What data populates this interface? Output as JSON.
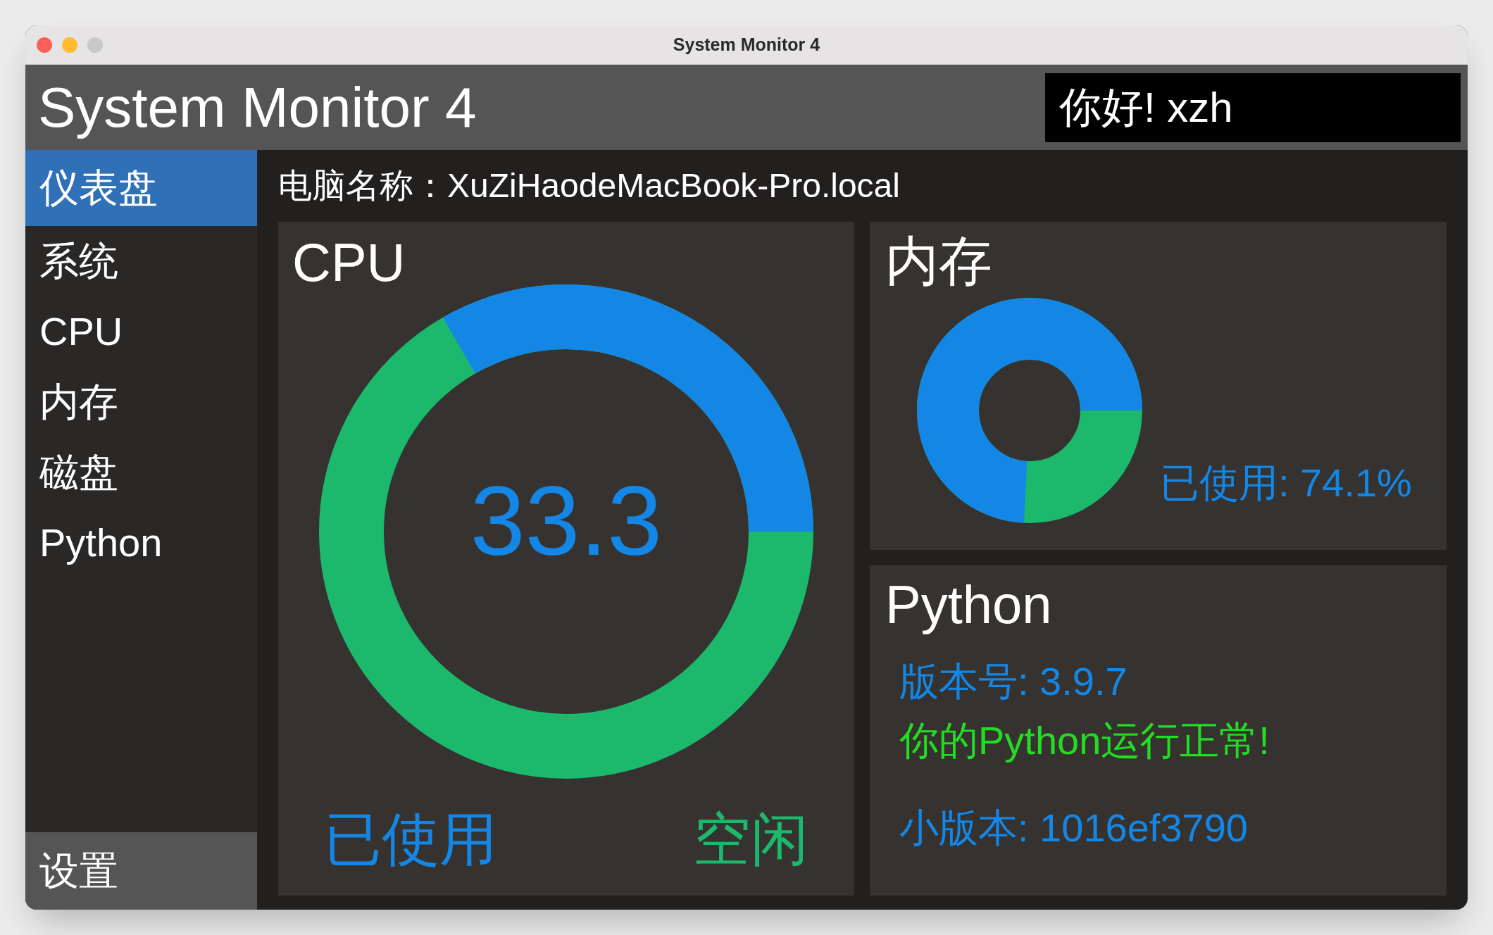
{
  "window": {
    "title": "System Monitor 4"
  },
  "header": {
    "title": "System Monitor 4",
    "greeting": "你好! xzh"
  },
  "sidebar": {
    "items": [
      {
        "label": "仪表盘",
        "selected": true
      },
      {
        "label": "系统",
        "selected": false
      },
      {
        "label": "CPU",
        "selected": false
      },
      {
        "label": "内存",
        "selected": false
      },
      {
        "label": "磁盘",
        "selected": false
      },
      {
        "label": "Python",
        "selected": false
      }
    ],
    "footer": "设置"
  },
  "computer_name": "电脑名称：XuZiHaodeMacBook-Pro.local",
  "cpu": {
    "title": "CPU",
    "value": "33.3",
    "level": 0.333,
    "legend_used": "已使用",
    "legend_free": "空闲"
  },
  "memory": {
    "title": "内存",
    "level": 0.741,
    "reading": "已使用: 74.1%"
  },
  "python": {
    "title": "Python",
    "version": "版本号: 3.9.7",
    "status": "你的Python运行正常!",
    "build": "小版本: 1016ef3790"
  }
}
